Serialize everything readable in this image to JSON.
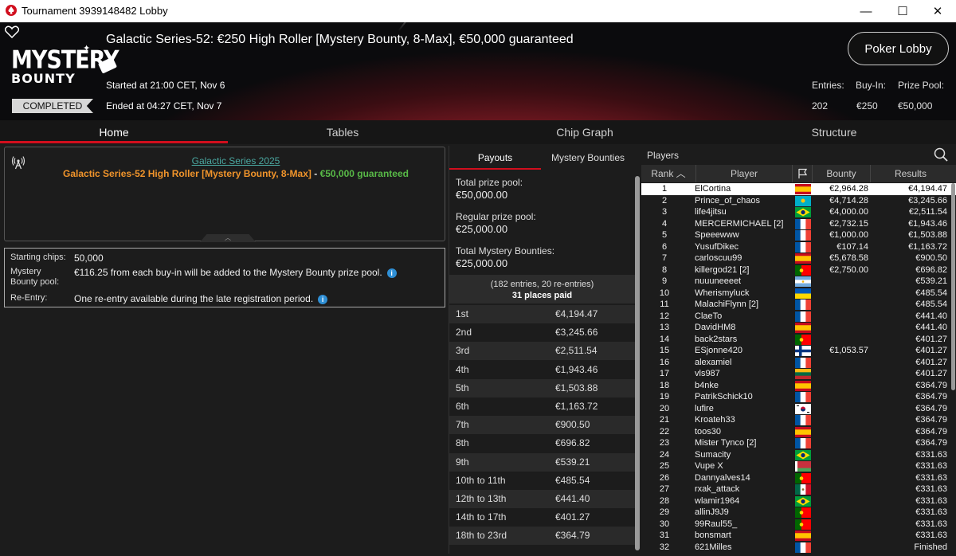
{
  "window": {
    "title": "Tournament 3939148482 Lobby",
    "minimize": "—",
    "maximize": "☐",
    "close": "✕"
  },
  "banner": {
    "title": "Galactic Series-52: €250 High Roller [Mystery Bounty, 8-Max], €50,000 guaranteed",
    "logo_line1": "MYSTERY",
    "logo_line2": "BOUNTY",
    "status": "COMPLETED",
    "started": "Started at 21:00 CET, Nov 6",
    "ended": "Ended at 04:27 CET, Nov 7",
    "lobby_button": "Poker Lobby",
    "stats": {
      "entries_label": "Entries:",
      "entries": "202",
      "buyin_label": "Buy-In:",
      "buyin": "€250",
      "prize_label": "Prize Pool:",
      "prize": "€50,000"
    }
  },
  "tabs": [
    "Home",
    "Tables",
    "Chip Graph",
    "Structure"
  ],
  "info": {
    "series": "Galactic Series 2025",
    "event": "Galactic Series-52 High Roller [Mystery Bounty, 8-Max]",
    "dash": " - ",
    "guarantee": "€50,000 guaranteed"
  },
  "details": {
    "starting_chips_label": "Starting chips:",
    "starting_chips": "50,000",
    "mystery_label": "Mystery Bounty pool:",
    "mystery_text": "€116.25 from each buy-in will be added to the Mystery Bounty prize pool.",
    "reentry_label": "Re-Entry:",
    "reentry_text": "One re-entry available during the late registration period."
  },
  "payouts": {
    "tab_payouts": "Payouts",
    "tab_bounties": "Mystery Bounties",
    "total_label": "Total prize pool:",
    "total": "€50,000.00",
    "regular_label": "Regular prize pool:",
    "regular": "€25,000.00",
    "mystery_label": "Total Mystery Bounties:",
    "mystery": "€25,000.00",
    "entries_line": "(182 entries, 20 re-entries)",
    "places_line": "31 places paid",
    "rows": [
      {
        "place": "1st",
        "amount": "€4,194.47"
      },
      {
        "place": "2nd",
        "amount": "€3,245.66"
      },
      {
        "place": "3rd",
        "amount": "€2,511.54"
      },
      {
        "place": "4th",
        "amount": "€1,943.46"
      },
      {
        "place": "5th",
        "amount": "€1,503.88"
      },
      {
        "place": "6th",
        "amount": "€1,163.72"
      },
      {
        "place": "7th",
        "amount": "€900.50"
      },
      {
        "place": "8th",
        "amount": "€696.82"
      },
      {
        "place": "9th",
        "amount": "€539.21"
      },
      {
        "place": "10th to 11th",
        "amount": "€485.54"
      },
      {
        "place": "12th to 13th",
        "amount": "€441.40"
      },
      {
        "place": "14th to 17th",
        "amount": "€401.27"
      },
      {
        "place": "18th to 23rd",
        "amount": "€364.79"
      }
    ]
  },
  "players": {
    "title": "Players",
    "col_rank": "Rank",
    "col_player": "Player",
    "col_bounty": "Bounty",
    "col_results": "Results",
    "rows": [
      {
        "rank": "1",
        "name": "ElCortina",
        "flag": "es",
        "bounty": "€2,964.28",
        "result": "€4,194.47"
      },
      {
        "rank": "2",
        "name": "Prince_of_chaos",
        "flag": "kz",
        "bounty": "€4,714.28",
        "result": "€3,245.66"
      },
      {
        "rank": "3",
        "name": "life4jitsu",
        "flag": "br",
        "bounty": "€4,000.00",
        "result": "€2,511.54"
      },
      {
        "rank": "4",
        "name": "MERCERMICHAEL [2]",
        "flag": "fr",
        "bounty": "€2,732.15",
        "result": "€1,943.46"
      },
      {
        "rank": "5",
        "name": "Speeewww",
        "flag": "fr",
        "bounty": "€1,000.00",
        "result": "€1,503.88"
      },
      {
        "rank": "6",
        "name": "YusufDikec",
        "flag": "fr",
        "bounty": "€107.14",
        "result": "€1,163.72"
      },
      {
        "rank": "7",
        "name": "carloscuu99",
        "flag": "es",
        "bounty": "€5,678.58",
        "result": "€900.50"
      },
      {
        "rank": "8",
        "name": "killergod21 [2]",
        "flag": "pt",
        "bounty": "€2,750.00",
        "result": "€696.82"
      },
      {
        "rank": "9",
        "name": "nuuuneeeet",
        "flag": "ar",
        "bounty": "",
        "result": "€539.21"
      },
      {
        "rank": "10",
        "name": "Wherismyluck",
        "flag": "ua",
        "bounty": "",
        "result": "€485.54"
      },
      {
        "rank": "11",
        "name": "MalachiFlynn [2]",
        "flag": "fr",
        "bounty": "",
        "result": "€485.54"
      },
      {
        "rank": "12",
        "name": "ClaeTo",
        "flag": "fr",
        "bounty": "",
        "result": "€441.40"
      },
      {
        "rank": "13",
        "name": "DavidHM8",
        "flag": "es",
        "bounty": "",
        "result": "€441.40"
      },
      {
        "rank": "14",
        "name": "back2stars",
        "flag": "pt",
        "bounty": "",
        "result": "€401.27"
      },
      {
        "rank": "15",
        "name": "ESjonne420",
        "flag": "fi",
        "bounty": "€1,053.57",
        "result": "€401.27"
      },
      {
        "rank": "16",
        "name": "alexamiel",
        "flag": "fr",
        "bounty": "",
        "result": "€401.27"
      },
      {
        "rank": "17",
        "name": "vls987",
        "flag": "lt",
        "bounty": "",
        "result": "€401.27"
      },
      {
        "rank": "18",
        "name": "b4nke",
        "flag": "es",
        "bounty": "",
        "result": "€364.79"
      },
      {
        "rank": "19",
        "name": "PatrikSchick10",
        "flag": "fr",
        "bounty": "",
        "result": "€364.79"
      },
      {
        "rank": "20",
        "name": "lufire",
        "flag": "kr",
        "bounty": "",
        "result": "€364.79"
      },
      {
        "rank": "21",
        "name": "Kroateh33",
        "flag": "fr",
        "bounty": "",
        "result": "€364.79"
      },
      {
        "rank": "22",
        "name": "toos30",
        "flag": "es",
        "bounty": "",
        "result": "€364.79"
      },
      {
        "rank": "23",
        "name": "Mister Tynco [2]",
        "flag": "fr",
        "bounty": "",
        "result": "€364.79"
      },
      {
        "rank": "24",
        "name": "Sumacity",
        "flag": "br",
        "bounty": "",
        "result": "€331.63"
      },
      {
        "rank": "25",
        "name": "Vupe X",
        "flag": "by",
        "bounty": "",
        "result": "€331.63"
      },
      {
        "rank": "26",
        "name": "Dannyalves14",
        "flag": "pt",
        "bounty": "",
        "result": "€331.63"
      },
      {
        "rank": "27",
        "name": "rxak_attack",
        "flag": "mx",
        "bounty": "",
        "result": "€331.63"
      },
      {
        "rank": "28",
        "name": "wlamir1964",
        "flag": "br",
        "bounty": "",
        "result": "€331.63"
      },
      {
        "rank": "29",
        "name": "allinJ9J9",
        "flag": "pt",
        "bounty": "",
        "result": "€331.63"
      },
      {
        "rank": "30",
        "name": "99Raul55_",
        "flag": "pt",
        "bounty": "",
        "result": "€331.63"
      },
      {
        "rank": "31",
        "name": "bonsmart",
        "flag": "es",
        "bounty": "",
        "result": "€331.63"
      },
      {
        "rank": "32",
        "name": "621Milles",
        "flag": "fr",
        "bounty": "",
        "result": "Finished"
      }
    ]
  },
  "colors": {
    "accent": "#d10e1d",
    "link": "#4aa7a0",
    "event": "#f0942b",
    "guarantee": "#58b947",
    "info": "#2f8fd5"
  }
}
